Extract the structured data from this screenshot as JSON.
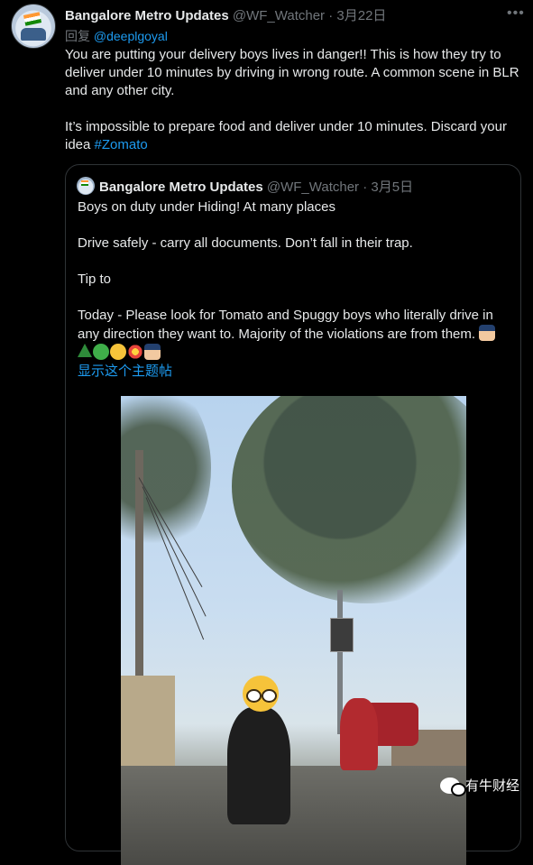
{
  "tweet": {
    "author_name": "Bangalore Metro Updates",
    "handle": "@WF_Watcher",
    "separator": "·",
    "date": "3月22日",
    "more_icon": "more-horizontal-icon",
    "reply_prefix": "回复",
    "reply_to": "@deeplgoyal",
    "paragraph_1": "You are putting your delivery boys lives in danger!! This is how they try to deliver under 10 minutes by driving in wrong route. A common scene in BLR and any other city.",
    "paragraph_2": "It’s impossible to prepare food and deliver under 10 minutes. Discard your idea",
    "hashtag": "#Zomato"
  },
  "quoted_tweet": {
    "author_name": "Bangalore Metro Updates",
    "handle": "@WF_Watcher",
    "separator": "·",
    "date": "3月5日",
    "line_1": "Boys  on duty under   Hiding! At many places",
    "line_2": "Drive safely - carry all documents. Don’t fall in their trap.",
    "line_3": "Tip to",
    "line_4": "Today - Please look for Tomato and Spuggy boys who literally drive in any direction they want to. Majority of the violations are from them.",
    "emojis": [
      "police-officer-emoji",
      "evergreen-tree-emoji",
      "deciduous-tree-emoji",
      "grinning-face-emoji",
      "collision-emoji",
      "police-officer-emoji"
    ],
    "show_thread": "显示这个主题帖"
  },
  "watermark": {
    "text": "有牛财经",
    "icon": "wechat-icon"
  },
  "colors": {
    "background": "#000000",
    "text": "#e7e9ea",
    "muted": "#71767b",
    "link": "#1d9bf0",
    "border": "#2f3336"
  }
}
